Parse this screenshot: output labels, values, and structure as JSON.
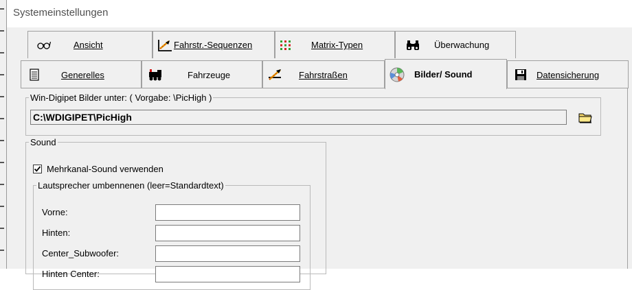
{
  "window": {
    "title": "Systemeinstellungen"
  },
  "tabs_row1": [
    {
      "label": "Ansicht",
      "icon": "glasses-icon"
    },
    {
      "label": "Fahrstr.-Sequenzen",
      "icon": "route-sequence-icon"
    },
    {
      "label": "Matrix-Typen",
      "icon": "matrix-icon"
    },
    {
      "label": "Überwachung",
      "icon": "binoculars-icon"
    }
  ],
  "tabs_row2": [
    {
      "label": "Generelles",
      "icon": "document-icon"
    },
    {
      "label": "Fahrzeuge",
      "icon": "locomotive-icon"
    },
    {
      "label": "Fahrstraßen",
      "icon": "route-icon"
    },
    {
      "label": "Bilder/ Sound",
      "icon": "cd-icon",
      "active": true
    },
    {
      "label": "Datensicherung",
      "icon": "floppy-icon"
    }
  ],
  "images": {
    "legend": "Win-Digipet Bilder unter:  ( Vorgabe: \\PicHigh )",
    "path": "C:\\WDIGIPET\\PicHigh",
    "browse_icon": "folder-icon"
  },
  "sound": {
    "legend": "Sound",
    "multichannel_label": "Mehrkanal-Sound verwenden",
    "multichannel_checked": true,
    "speakers": {
      "legend": "Lautsprecher umbennenen (leer=Standardtext)",
      "fields": [
        {
          "label": "Vorne:",
          "value": ""
        },
        {
          "label": "Hinten:",
          "value": ""
        },
        {
          "label": "Center_Subwoofer:",
          "value": ""
        },
        {
          "label": "Hinten Center:",
          "value": ""
        }
      ]
    }
  }
}
